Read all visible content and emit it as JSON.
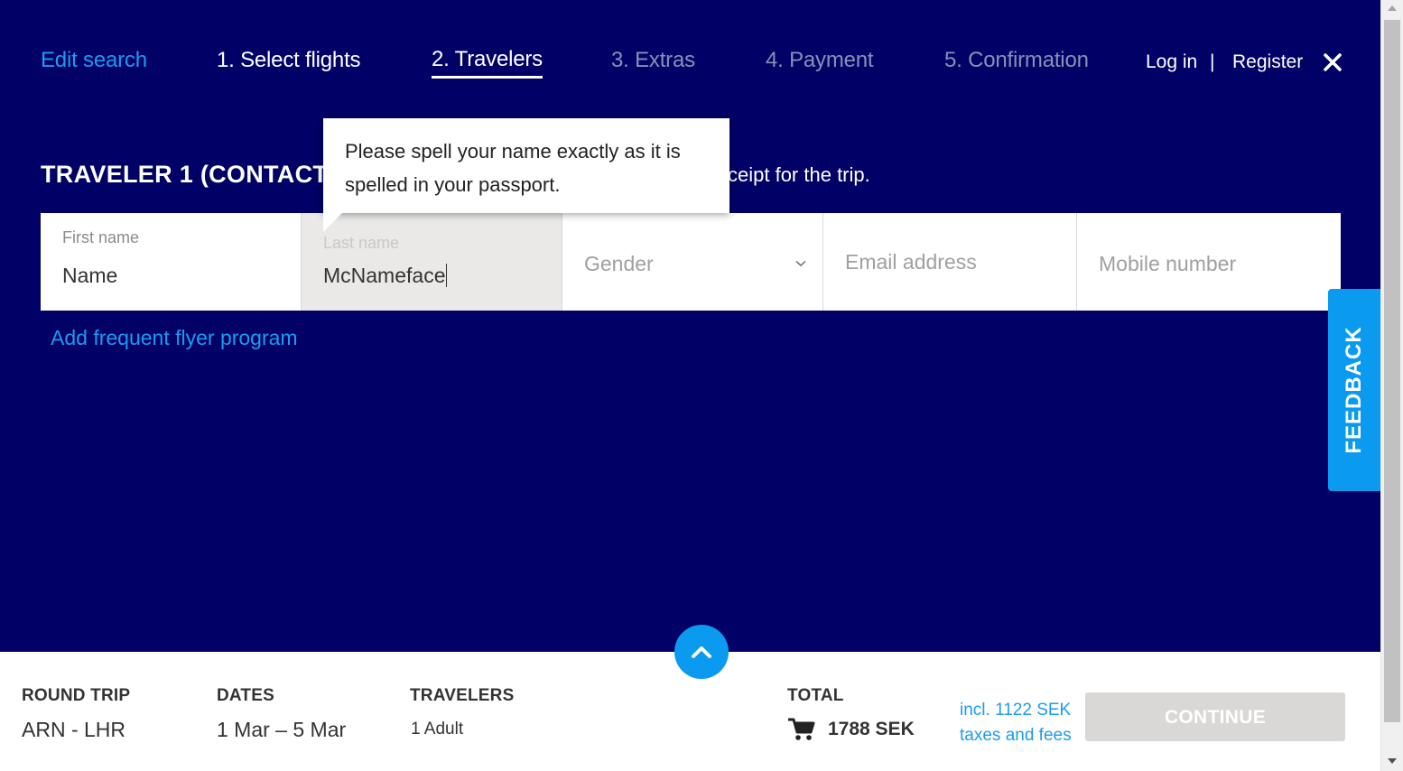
{
  "header": {
    "edit_search": "Edit search",
    "steps": [
      "1. Select flights",
      "2. Travelers",
      "3. Extras",
      "4. Payment",
      "5. Confirmation"
    ],
    "log_in": "Log in",
    "separator": "|",
    "register": "Register",
    "close_icon": "close-icon"
  },
  "traveler": {
    "heading": "TRAVELER 1 (CONTACT",
    "description": "ceipt for the trip.",
    "tooltip": "Please spell your name exactly as it is spelled in your passport.",
    "fields": {
      "first_name_label": "First name",
      "first_name_value": "Name",
      "last_name_label": "Last name",
      "last_name_value": "McNameface",
      "gender_placeholder": "Gender",
      "email_placeholder": "Email address",
      "mobile_placeholder": "Mobile number"
    },
    "frequent_flyer_link": "Add frequent flyer program"
  },
  "feedback": "FEEDBACK",
  "summary": {
    "trip_type_label": "ROUND TRIP",
    "route": "ARN - LHR",
    "dates_label": "DATES",
    "dates": "1 Mar – 5 Mar",
    "travelers_label": "TRAVELERS",
    "travelers": "1 Adult",
    "total_label": "TOTAL",
    "total": "1788 SEK",
    "taxes_line1": "incl. 1122 SEK",
    "taxes_line2": "taxes and fees",
    "continue": "CONTINUE"
  },
  "colors": {
    "background": "#000066",
    "accent": "#1a9cf0",
    "button_disabled": "#d9d8d6"
  }
}
